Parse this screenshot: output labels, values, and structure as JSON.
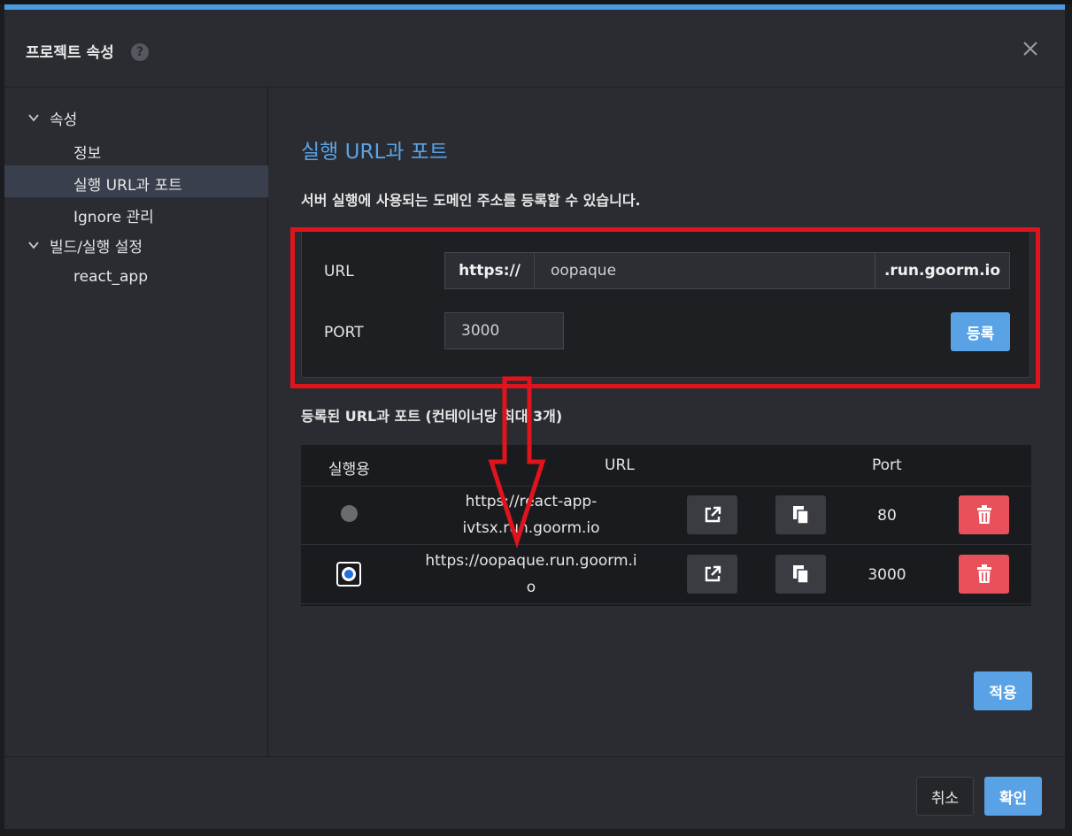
{
  "dialog": {
    "title": "프로젝트 속성",
    "help_icon": "question-circle-icon",
    "close_icon": "close-icon",
    "accent_color": "#4a9be2"
  },
  "sidebar": {
    "groups": [
      {
        "label": "속성",
        "items": [
          "정보",
          "실행 URL과 포트",
          "Ignore 관리"
        ]
      },
      {
        "label": "빌드/실행 설정",
        "items": [
          "react_app"
        ]
      }
    ],
    "active_item": "실행 URL과 포트"
  },
  "main": {
    "title": "실행 URL과 포트",
    "description": "서버 실행에 사용되는 도메인 주소를 등록할 수 있습니다.",
    "form": {
      "url_label": "URL",
      "url_prefix": "https://",
      "url_value": "oopaque",
      "url_suffix": ".run.goorm.io",
      "port_label": "PORT",
      "port_value": "3000",
      "register_button": "등록"
    },
    "list_title": "등록된 URL과 포트 (컨테이너당 최대 3개)",
    "table": {
      "headers": [
        "실행용",
        "URL",
        "Port"
      ],
      "rows": [
        {
          "selected": false,
          "url_line1": "https://react-app-",
          "url_line2": "ivtsx.run.goorm.io",
          "port": "80"
        },
        {
          "selected": true,
          "url_line1": "https://oopaque.run.goorm.i",
          "url_line2": "o",
          "port": "3000"
        }
      ]
    },
    "apply_button": "적용"
  },
  "footer": {
    "cancel_button": "취소",
    "ok_button": "확인"
  },
  "colors": {
    "highlight_frame": "#e0141d",
    "primary_button": "#5aa2e6",
    "danger_button": "#e8505b",
    "title_blue": "#5aa3e8"
  }
}
